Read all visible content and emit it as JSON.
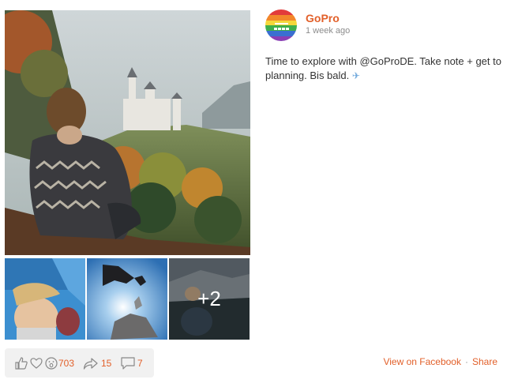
{
  "post": {
    "author": "GoPro",
    "time": "1 week ago",
    "text": "Time to explore with @GoProDE. Take note + get to planning. Bis bald.",
    "emoji_icon": "airplane-icon"
  },
  "gallery": {
    "more_label": "+2"
  },
  "reactions": {
    "count": "703",
    "shares": "15",
    "comments": "7"
  },
  "footer": {
    "view_on_facebook": "View on Facebook",
    "separator": "·",
    "share": "Share"
  },
  "colors": {
    "accent": "#e2602a",
    "muted": "#8c8c8c",
    "bar_bg": "#f1f1f1"
  }
}
